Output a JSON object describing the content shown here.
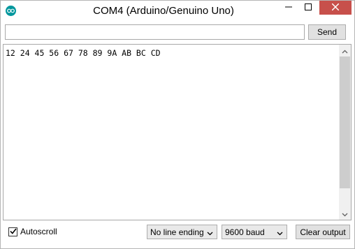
{
  "window": {
    "title": "COM4 (Arduino/Genuino Uno)",
    "app_icon": "arduino-icon",
    "close_color": "#c7504b"
  },
  "send": {
    "input_value": "",
    "button_label": "Send"
  },
  "output": {
    "text": "12 24 45 56 67 78 89 9A AB BC CD"
  },
  "bottom": {
    "autoscroll_label": "Autoscroll",
    "autoscroll_checked": true,
    "line_ending_value": "No line ending",
    "baud_value": "9600 baud",
    "clear_label": "Clear output"
  }
}
